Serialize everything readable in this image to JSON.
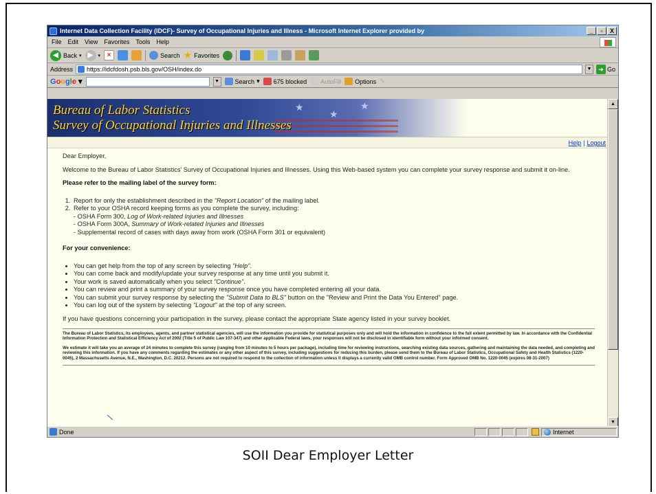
{
  "window": {
    "title": "Internet Data Collection Facility (IDCF)- Survey of Occupational Injuries and Illness - Microsoft Internet Explorer provided by",
    "controls": [
      "_",
      "▫",
      "X"
    ]
  },
  "menu": [
    "File",
    "Edit",
    "View",
    "Favorites",
    "Tools",
    "Help"
  ],
  "toolbar": {
    "back": "Back",
    "search": "Search",
    "favorites": "Favorites"
  },
  "address": {
    "label": "Address",
    "url": "https://idcfdosh.psb.bls.gov/OSH/index.do",
    "go": "Go"
  },
  "google": {
    "logo": [
      "G",
      "o",
      "o",
      "g",
      "l",
      "e"
    ],
    "search": "Search",
    "blocked": "675 blocked",
    "autofill": "AutoFill",
    "options": "Options"
  },
  "banner": {
    "line1": "Bureau of Labor Statistics",
    "line2": "Survey of Occupational Injuries and Illnesses"
  },
  "links": {
    "help": "Help",
    "separator": "|",
    "logout": "Logout"
  },
  "letter": {
    "greeting": "Dear Employer,",
    "welcome": "Welcome to the Bureau of Labor Statistics' Survey of Occupational Injuries and Illnesses. Using this Web-based system you can complete your survey response and submit it on-line.",
    "heading1": "Please refer to the mailing label of the survey form:",
    "item1_a": "Report for only the establishment described in the ",
    "item1_em": "\"Report Location\"",
    "item1_b": " of the mailing label.",
    "item2": "Refer to your OSHA record keeping forms as you complete the survey, including:",
    "sub1_a": "- OSHA Form 300, ",
    "sub1_em": "Log of Work-related Injuries and Illnesses",
    "sub2_a": "- OSHA Form 300A, ",
    "sub2_em": "Summary of Work-related Injuries and Illnesses",
    "sub3": "- Supplemental record of cases with days away from work (OSHA Form 301 or equivalent)",
    "heading2": "For your convenience:",
    "bullet1_a": "You can get help from the top of any screen by selecting ",
    "bullet1_em": "\"Help\"",
    "bullet1_b": ".",
    "bullet2": "You can come back and modify/update your survey response at any time until you submit it.",
    "bullet3_a": "Your work is saved automatically when you select ",
    "bullet3_em": "\"Continue\"",
    "bullet3_b": ".",
    "bullet4": "You can review and print a summary of your survey response once you have completed entering all your data.",
    "bullet5_a": "You can submit your survey response by selecting the ",
    "bullet5_em": "\"Submit Data to BLS\"",
    "bullet5_b": " button on the \"Review and Print the Data You Entered\" page.",
    "bullet6_a": "You can log out of the system by selecting ",
    "bullet6_em": "\"Logout\"",
    "bullet6_b": " at the top of any screen.",
    "questions": "If you have questions concerning your participation in the survey, please contact the appropriate State agency listed in your survey booklet.",
    "legal1": "The Bureau of Labor Statistics, its employees, agents, and partner statistical agencies, will use the information you provide for statistical purposes only and will hold the information in confidence to the full extent permitted by law. In accordance with the Confidential Information Protection and Statistical Efficiency Act of 2002 (Title 5 of Public Law 107-347) and other applicable Federal laws, your responses will not be disclosed in identifiable form without your informed consent.",
    "legal2": "We estimate it will take you an average of 24 minutes to complete this survey (ranging from 10 minutes to 5 hours per package), including time for reviewing instructions, searching existing data sources, gathering and maintaining the data needed, and completing and reviewing this information. If you have any comments regarding the estimates or any other aspect of this survey, including suggestions for reducing this burden, please send them to the Bureau of Labor Statistics, Occupational Safety and Health Statistics (1220-0045), 2 Massachusetts Avenue, N.E., Washington, D.C. 20212. Persons are not required to respond to the collection of information unless it displays a currently valid OMB control number. Form Approved OMB No. 1220-0045 (expires 08-31-2007)"
  },
  "status": {
    "text": "Done",
    "zone": "Internet"
  },
  "caption": "SOII Dear Employer Letter"
}
